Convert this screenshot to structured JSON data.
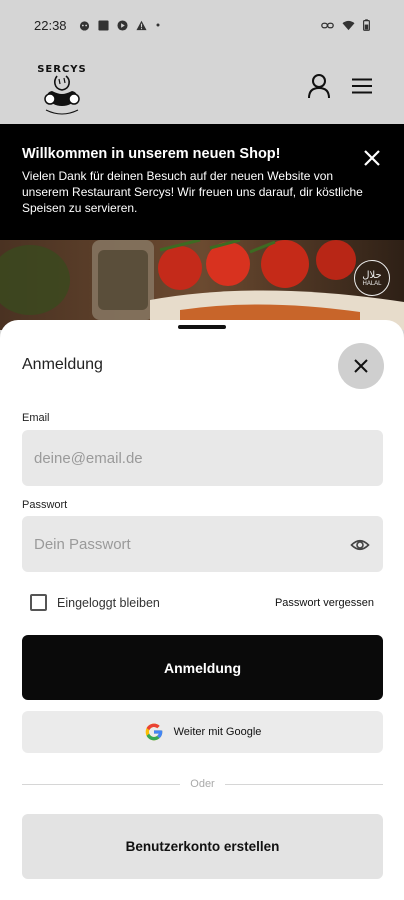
{
  "status_bar": {
    "time": "22:38",
    "left_icons": [
      "cat-face-icon",
      "square-icon",
      "play-circle-icon",
      "warning-icon",
      "dot-icon"
    ],
    "right_icons": [
      "link-icon",
      "wifi-icon",
      "battery-icon"
    ]
  },
  "header": {
    "logo_text": "SERCYS",
    "account_icon": "person-icon",
    "menu_icon": "hamburger-menu-icon"
  },
  "banner": {
    "title": "Willkommen in unserem neuen Shop!",
    "text": "Vielen Dank für deinen Besuch auf der neuen Website von unserem Restaurant Sercys! Wir freuen uns darauf, dir köstliche Speisen zu servieren.",
    "close_icon": "close-icon"
  },
  "hero": {
    "badge_arabic": "حلال",
    "badge_text": "HALAL"
  },
  "login_sheet": {
    "title": "Anmeldung",
    "email_label": "Email",
    "email_placeholder": "deine@email.de",
    "email_value": "",
    "password_label": "Passwort",
    "password_placeholder": "Dein Passwort",
    "password_value": "",
    "remember_label": "Eingeloggt bleiben",
    "remember_checked": false,
    "forgot_label": "Passwort vergessen",
    "submit_label": "Anmeldung",
    "google_label": "Weiter mit Google",
    "divider_label": "Oder",
    "create_account_label": "Benutzerkonto erstellen"
  },
  "colors": {
    "background": "#d5d5d5",
    "banner": "#000000",
    "primary_button": "#0a0a0a",
    "input_fill": "#e8e8e8",
    "google_blue": "#4285F4",
    "google_red": "#EA4335",
    "google_yellow": "#FBBC05",
    "google_green": "#34A853"
  }
}
